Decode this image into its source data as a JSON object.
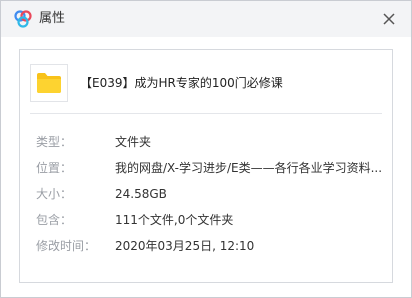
{
  "window": {
    "title": "属性",
    "close_icon": "close-icon",
    "app_icon": "baidu-netdisk-logo"
  },
  "file": {
    "name": "【E039】成为HR专家的100门必修课",
    "icon": "folder-icon",
    "icon_color": "#F5C518"
  },
  "properties": [
    {
      "label": "类型：",
      "value": "文件夹"
    },
    {
      "label": "位置：",
      "value": "我的网盘/X-学习进步/E类——各行各业学习资料..."
    },
    {
      "label": "大小：",
      "value": "24.58GB"
    },
    {
      "label": "包含：",
      "value": "111个文件,0个文件夹"
    },
    {
      "label": "修改时间：",
      "value": "2020年03月25日, 12:10"
    }
  ]
}
